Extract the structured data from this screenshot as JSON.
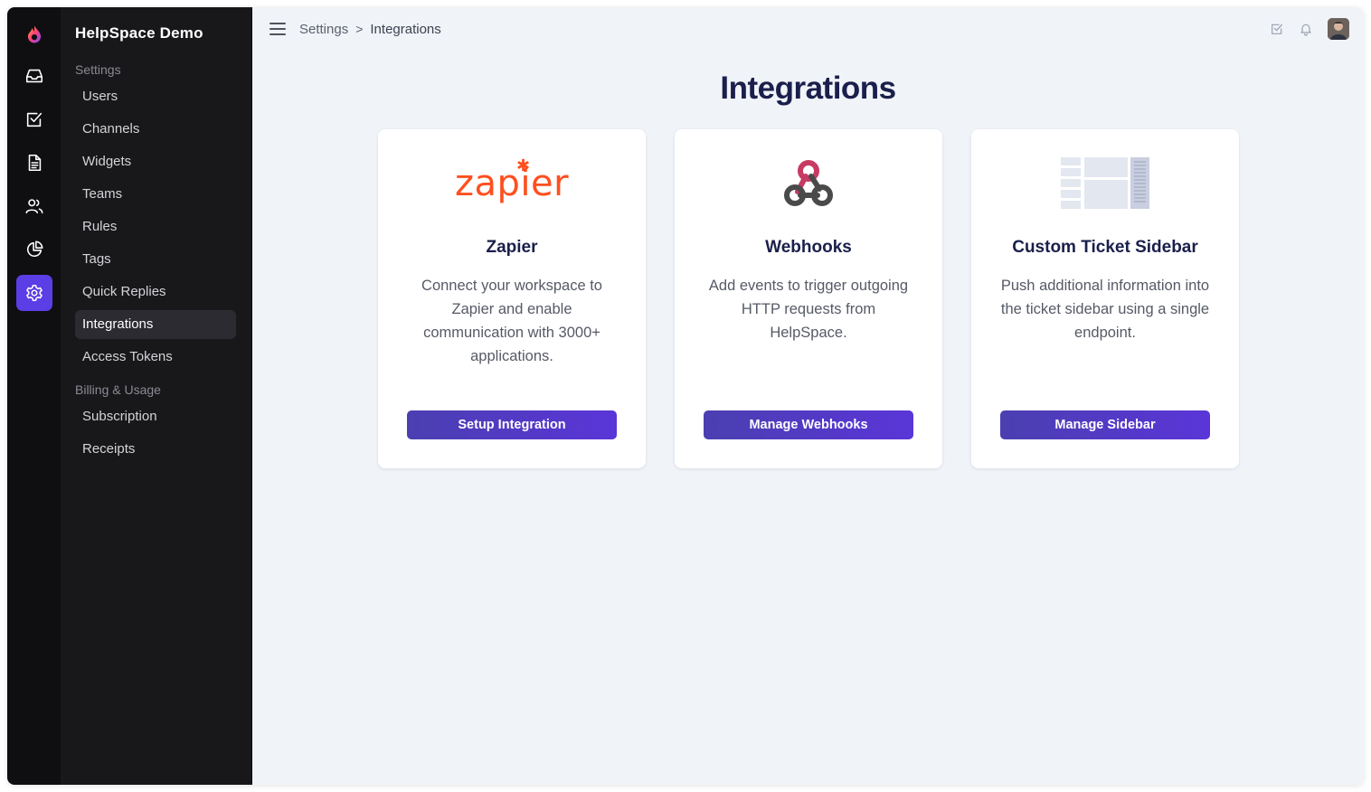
{
  "app": {
    "org_name": "HelpSpace Demo"
  },
  "rail": {
    "items": [
      {
        "icon": "inbox-icon"
      },
      {
        "icon": "task-check-icon"
      },
      {
        "icon": "document-icon"
      },
      {
        "icon": "users-icon"
      },
      {
        "icon": "pie-chart-icon"
      },
      {
        "icon": "gear-icon",
        "active": true
      }
    ]
  },
  "sidebar": {
    "group1": "Settings",
    "items": [
      {
        "label": "Users"
      },
      {
        "label": "Channels"
      },
      {
        "label": "Widgets"
      },
      {
        "label": "Teams"
      },
      {
        "label": "Rules"
      },
      {
        "label": "Tags"
      },
      {
        "label": "Quick Replies"
      },
      {
        "label": "Integrations",
        "active": true
      },
      {
        "label": "Access Tokens"
      }
    ],
    "group2": "Billing & Usage",
    "items2": [
      {
        "label": "Subscription"
      },
      {
        "label": "Receipts"
      }
    ]
  },
  "breadcrumb": {
    "parent": "Settings",
    "separator": ">",
    "current": "Integrations"
  },
  "page": {
    "title": "Integrations"
  },
  "cards": [
    {
      "logo_text": "zapier",
      "title": "Zapier",
      "description": "Connect your workspace to Zapier and enable communication with 3000+ applications.",
      "button": "Setup Integration"
    },
    {
      "title": "Webhooks",
      "description": "Add events to trigger outgoing HTTP requests from HelpSpace.",
      "button": "Manage Webhooks"
    },
    {
      "title": "Custom Ticket Sidebar",
      "description": "Push additional information into the ticket sidebar using a single endpoint.",
      "button": "Manage Sidebar"
    }
  ],
  "colors": {
    "accent": "#5b3ee6",
    "zapier": "#ff4f1f",
    "heading": "#1a1f4b"
  }
}
